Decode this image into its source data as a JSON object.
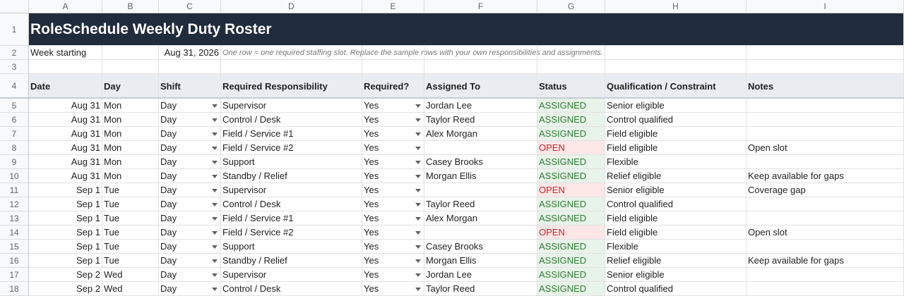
{
  "columns": [
    "A",
    "B",
    "C",
    "D",
    "E",
    "F",
    "G",
    "H",
    "I"
  ],
  "title": "RoleSchedule Weekly Duty Roster",
  "week": {
    "label": "Week starting",
    "value": "Aug 31, 2026",
    "note": "One row = one required staffing slot. Replace the sample rows with your own responsibilities and assignments."
  },
  "headers": [
    "Date",
    "Day",
    "Shift",
    "Required Responsibility",
    "Required?",
    "Assigned To",
    "Status",
    "Qualification / Constraint",
    "Notes"
  ],
  "colors": {
    "title_bg": "#202b3b",
    "assigned": "#2e7d32",
    "open": "#c62828"
  },
  "rows": [
    {
      "num": "5",
      "date": "Aug 31",
      "day": "Mon",
      "shift": "Day",
      "resp": "Supervisor",
      "req": "Yes",
      "assigned": "Jordan Lee",
      "status": "ASSIGNED",
      "qual": "Senior eligible",
      "notes": ""
    },
    {
      "num": "6",
      "date": "Aug 31",
      "day": "Mon",
      "shift": "Day",
      "resp": "Control / Desk",
      "req": "Yes",
      "assigned": "Taylor Reed",
      "status": "ASSIGNED",
      "qual": "Control qualified",
      "notes": ""
    },
    {
      "num": "7",
      "date": "Aug 31",
      "day": "Mon",
      "shift": "Day",
      "resp": "Field / Service #1",
      "req": "Yes",
      "assigned": "Alex Morgan",
      "status": "ASSIGNED",
      "qual": "Field eligible",
      "notes": ""
    },
    {
      "num": "8",
      "date": "Aug 31",
      "day": "Mon",
      "shift": "Day",
      "resp": "Field / Service #2",
      "req": "Yes",
      "assigned": "",
      "status": "OPEN",
      "qual": "Field eligible",
      "notes": "Open slot"
    },
    {
      "num": "9",
      "date": "Aug 31",
      "day": "Mon",
      "shift": "Day",
      "resp": "Support",
      "req": "Yes",
      "assigned": "Casey Brooks",
      "status": "ASSIGNED",
      "qual": "Flexible",
      "notes": ""
    },
    {
      "num": "10",
      "date": "Aug 31",
      "day": "Mon",
      "shift": "Day",
      "resp": "Standby / Relief",
      "req": "Yes",
      "assigned": "Morgan Ellis",
      "status": "ASSIGNED",
      "qual": "Relief eligible",
      "notes": "Keep available for gaps"
    },
    {
      "num": "11",
      "date": "Sep 1",
      "day": "Tue",
      "shift": "Day",
      "resp": "Supervisor",
      "req": "Yes",
      "assigned": "",
      "status": "OPEN",
      "qual": "Senior eligible",
      "notes": "Coverage gap"
    },
    {
      "num": "12",
      "date": "Sep 1",
      "day": "Tue",
      "shift": "Day",
      "resp": "Control / Desk",
      "req": "Yes",
      "assigned": "Taylor Reed",
      "status": "ASSIGNED",
      "qual": "Control qualified",
      "notes": ""
    },
    {
      "num": "13",
      "date": "Sep 1",
      "day": "Tue",
      "shift": "Day",
      "resp": "Field / Service #1",
      "req": "Yes",
      "assigned": "Alex Morgan",
      "status": "ASSIGNED",
      "qual": "Field eligible",
      "notes": ""
    },
    {
      "num": "14",
      "date": "Sep 1",
      "day": "Tue",
      "shift": "Day",
      "resp": "Field / Service #2",
      "req": "Yes",
      "assigned": "",
      "status": "OPEN",
      "qual": "Field eligible",
      "notes": "Open slot"
    },
    {
      "num": "15",
      "date": "Sep 1",
      "day": "Tue",
      "shift": "Day",
      "resp": "Support",
      "req": "Yes",
      "assigned": "Casey Brooks",
      "status": "ASSIGNED",
      "qual": "Flexible",
      "notes": ""
    },
    {
      "num": "16",
      "date": "Sep 1",
      "day": "Tue",
      "shift": "Day",
      "resp": "Standby / Relief",
      "req": "Yes",
      "assigned": "Morgan Ellis",
      "status": "ASSIGNED",
      "qual": "Relief eligible",
      "notes": "Keep available for gaps"
    },
    {
      "num": "17",
      "date": "Sep 2",
      "day": "Wed",
      "shift": "Day",
      "resp": "Supervisor",
      "req": "Yes",
      "assigned": "Jordan Lee",
      "status": "ASSIGNED",
      "qual": "Senior eligible",
      "notes": ""
    },
    {
      "num": "18",
      "date": "Sep 2",
      "day": "Wed",
      "shift": "Day",
      "resp": "Control / Desk",
      "req": "Yes",
      "assigned": "Taylor Reed",
      "status": "ASSIGNED",
      "qual": "Control qualified",
      "notes": ""
    }
  ]
}
